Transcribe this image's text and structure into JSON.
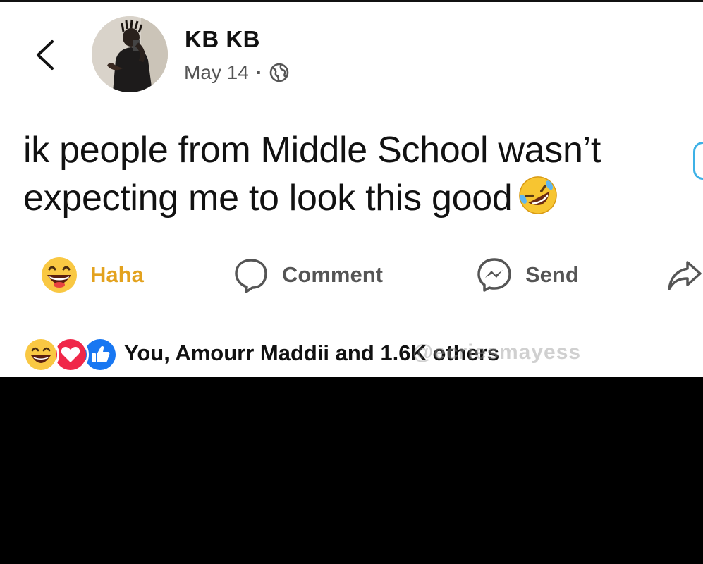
{
  "post": {
    "author_name": "KB KB",
    "date": "May 14",
    "separator": "·",
    "audience_icon": "globe-icon",
    "text": "ik people from Middle School wasn’t expecting me to look this good",
    "text_emoji": "rolling-on-floor-laughing-emoji"
  },
  "actions": {
    "haha_label": "Haha",
    "comment_label": "Comment",
    "send_label": "Send",
    "share_icon": "share-arrow-icon"
  },
  "reactions": {
    "summary_text": "You, Amourr Maddii and 1.6K others",
    "types": [
      "haha",
      "love",
      "like"
    ]
  },
  "watermark": {
    "text": "@ecriesmayess"
  },
  "colors": {
    "haha_active": "#e3a21e",
    "like_blue": "#1877f2",
    "love_red": "#f02849",
    "text_dark": "#111111",
    "text_muted": "#555555"
  }
}
